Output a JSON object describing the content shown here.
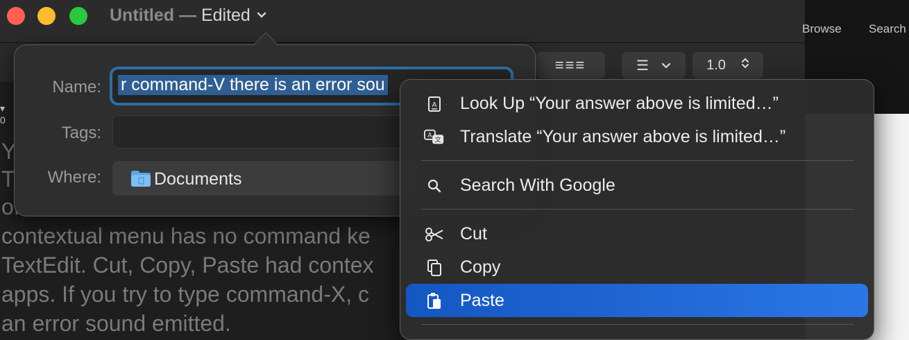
{
  "window": {
    "title": "Untitled —",
    "edited": "Edited",
    "chevron": "chevron-down-icon"
  },
  "browser": {
    "browse": "Browse",
    "search": "Search"
  },
  "toolbar": {
    "align_glyphs": "≡≡≡",
    "list_glyph": "☰",
    "list_chevron": "⌄",
    "spacing": "1.0",
    "spacing_stepper": "⌃⌄"
  },
  "document": {
    "lines": [
      "Y",
      "T",
      "of",
      "contextual menu has no command ke",
      "TextEdit. Cut, Copy, Paste had contex",
      "apps. If you try to type command-X, c",
      "an error sound emitted."
    ]
  },
  "save_sheet": {
    "name_label": "Name:",
    "name_value": "r command-V there is an error sou",
    "tags_label": "Tags:",
    "where_label": "Where:",
    "where_value": "Documents"
  },
  "context_menu": {
    "items": [
      {
        "label": "Look Up “Your answer above is limited…”",
        "icon": "dictionary-icon"
      },
      {
        "label": "Translate “Your answer above is limited…”",
        "icon": "translate-icon"
      },
      {
        "label": "Search With Google",
        "icon": "search-icon"
      },
      {
        "label": "Cut",
        "icon": "scissors-icon"
      },
      {
        "label": "Copy",
        "icon": "copy-icon"
      },
      {
        "label": "Paste",
        "icon": "paste-icon"
      }
    ],
    "active_item": "Paste"
  },
  "colors": {
    "accent": "#1e66d6",
    "red": "#fe5f57",
    "yellow": "#febc2e",
    "green": "#28c840"
  }
}
